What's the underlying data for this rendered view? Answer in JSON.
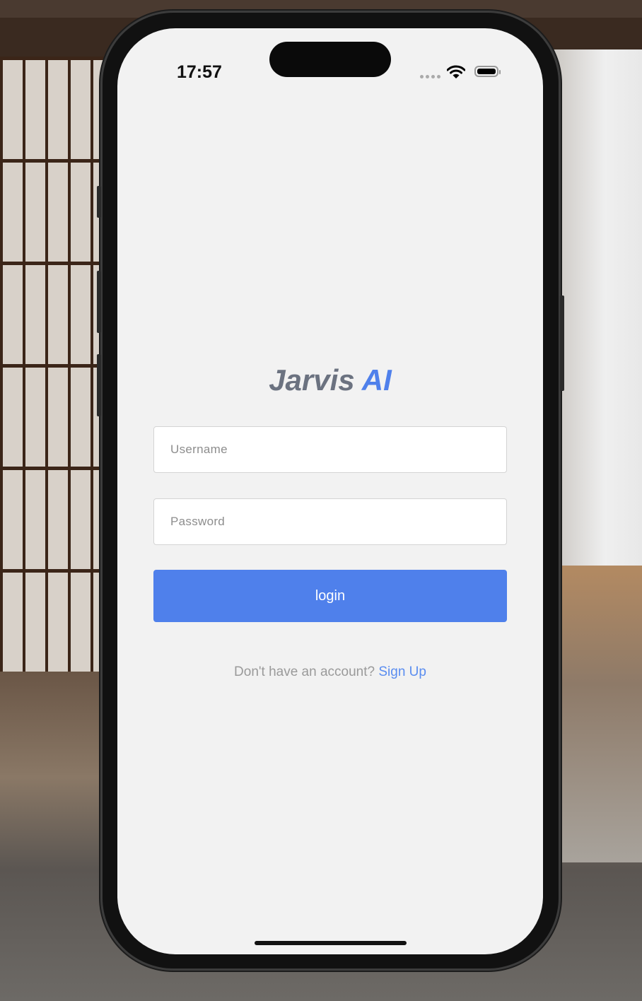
{
  "status_bar": {
    "time": "17:57",
    "signal_icon": "signal-dots-icon",
    "wifi_icon": "wifi-icon",
    "battery_icon": "battery-icon"
  },
  "app": {
    "title_part1": "Jarvis",
    "title_part2": "AI",
    "accent_color": "#4f80eb",
    "title_color": "#6b7280"
  },
  "form": {
    "username_placeholder": "Username",
    "username_value": "",
    "password_placeholder": "Password",
    "password_value": "",
    "login_label": "login"
  },
  "footer": {
    "prompt": "Don't have an account?",
    "signup_label": "Sign Up"
  }
}
